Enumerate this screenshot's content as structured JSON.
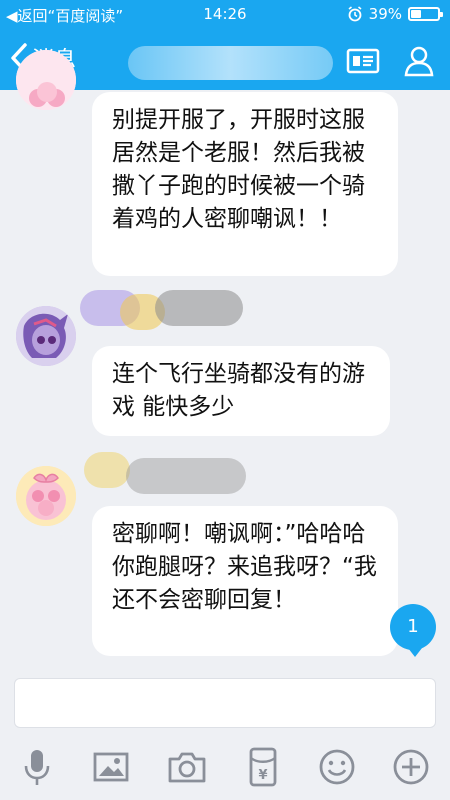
{
  "status_bar": {
    "back_app": "返回“百度阅读”",
    "time": "14:26",
    "battery_percent": "39%",
    "battery_level": 0.39
  },
  "nav": {
    "back_label": "消息"
  },
  "messages": [
    {
      "text": "别提开服了，开服时这服居然是个老服！然后我被撒丫子跑的时候被一个骑着鸡的人密聊嘲讽！！"
    },
    {
      "text": "连个飞行坐骑都没有的游戏 能快多少"
    },
    {
      "text": "密聊啊！嘲讽啊：”哈哈哈你跑腿呀？来追我呀？“我还不会密聊回复！"
    }
  ],
  "unread_count": "1",
  "colors": {
    "accent": "#1aa7f0",
    "chat_bg": "#eef0f4",
    "bubble": "#ffffff"
  },
  "toolbar_icons": [
    "microphone-icon",
    "image-icon",
    "camera-icon",
    "red-packet-icon",
    "emoji-icon",
    "plus-icon"
  ]
}
